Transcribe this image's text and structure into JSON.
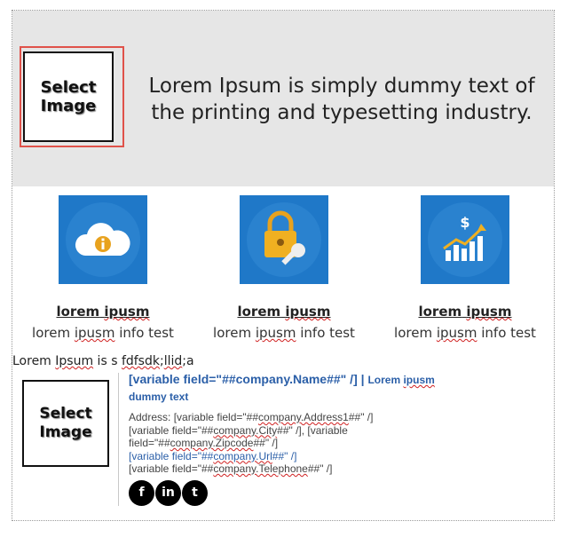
{
  "header": {
    "logo_text": "Select\nImage",
    "tagline": "Lorem Ipsum is simply dummy text of the printing and typesetting industry."
  },
  "features": [
    {
      "icon": "cloud-info-icon",
      "title_a": "lorem",
      "title_b": "ipusm",
      "sub_a": "lorem",
      "sub_b": "ipusm",
      "sub_c": " info test"
    },
    {
      "icon": "lock-key-icon",
      "title_a": "lorem",
      "title_b": "ipusm",
      "sub_a": "lorem",
      "sub_b": "ipusm",
      "sub_c": " info test"
    },
    {
      "icon": "dollar-chart-icon",
      "title_a": "lorem",
      "title_b": "ipusm",
      "sub_a": "lorem",
      "sub_b": "ipusm",
      "sub_c": " info test"
    }
  ],
  "info_line": {
    "a": "Lorem ",
    "b": "Ipsum",
    "c": " is s ",
    "d": "fdfsdk",
    "e": ";",
    "f": "llid",
    "g": ";a"
  },
  "signature": {
    "logo_text": "Select\nImage",
    "name_field": "[variable field=\"##company.Name##\" /]",
    "separator": " | ",
    "tagline_a": "Lorem ",
    "tagline_b": "ipusm",
    "tagline_c": "dummy text",
    "address_a": "Address: [variable field=\"##",
    "address_b": "company.Address1",
    "address_c": "##\" /]",
    "city_a": "[variable field=\"##",
    "city_b": "company.City",
    "city_c": "##\" /], [variable",
    "zip_a": "field=\"##",
    "zip_b": "company.Zipcode",
    "zip_c": "##\" /]",
    "url_a": "[variable field=\"##",
    "url_b": "company.Url",
    "url_c": "##\" /]",
    "tel_a": "[variable field=\"##",
    "tel_b": "company.Telephone",
    "tel_c": "##\" /]",
    "social": [
      {
        "icon": "facebook-icon",
        "glyph": "f"
      },
      {
        "icon": "linkedin-icon",
        "glyph": "in"
      },
      {
        "icon": "twitter-icon",
        "glyph": "t"
      }
    ]
  },
  "colors": {
    "header_bg": "#e6e6e6",
    "selection_outline": "#e0524a",
    "icon_tile": "#1f78c8",
    "link_blue": "#2b5fa8"
  }
}
